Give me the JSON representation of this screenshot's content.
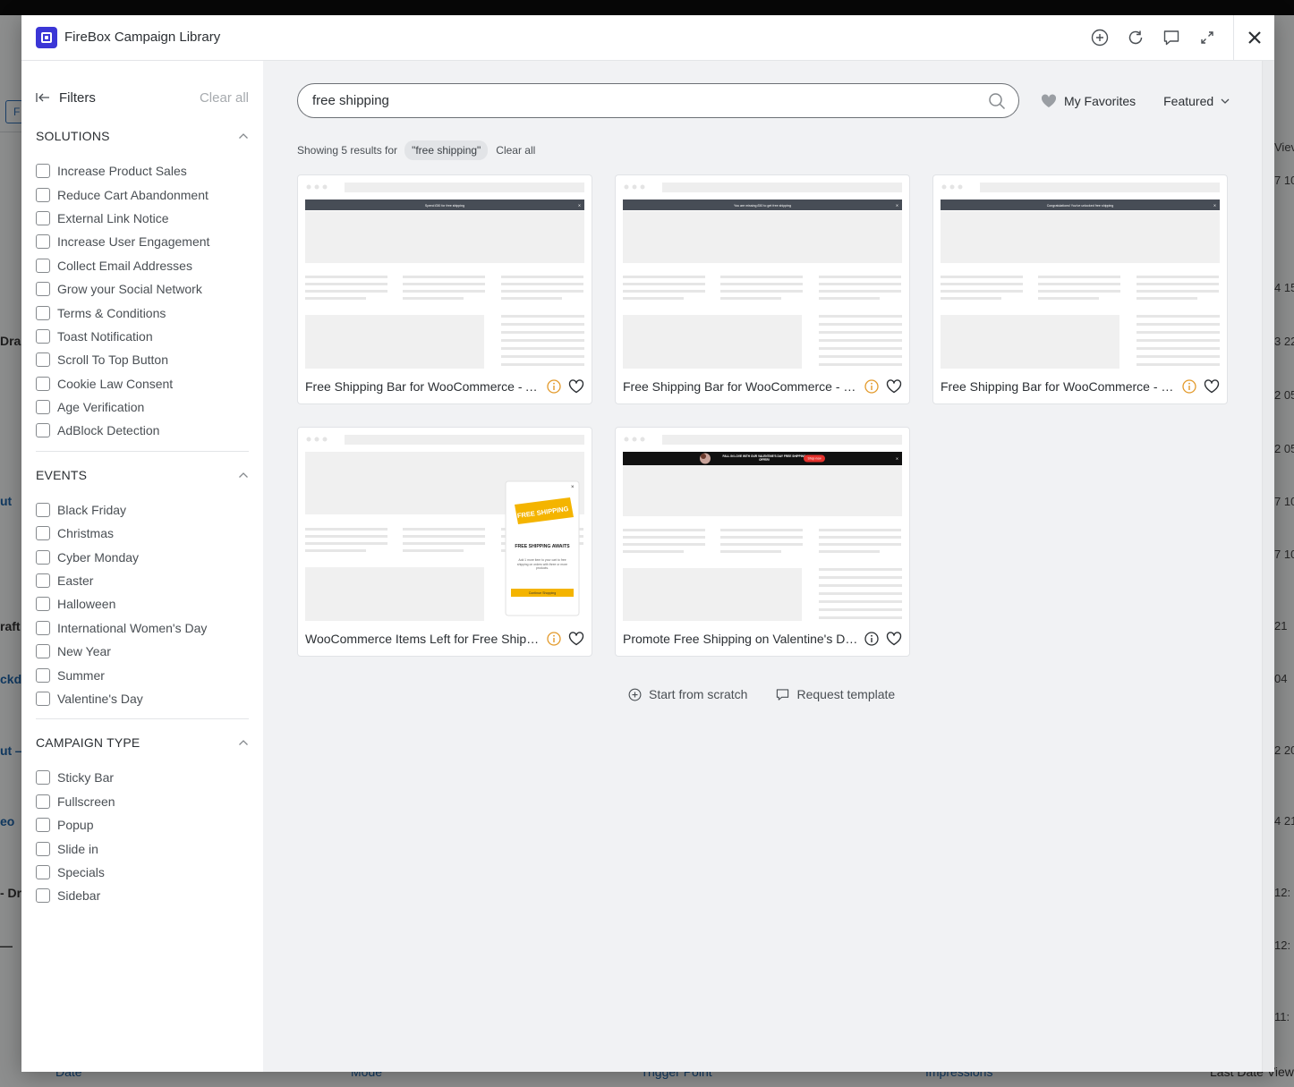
{
  "background": {
    "left_fragments": [
      "Dra",
      "ut",
      "raft",
      "ckd",
      "ut —",
      "eo",
      "- Dr",
      "—"
    ],
    "right_fragments": [
      "Viev",
      "7 10",
      "4 15",
      "3 22",
      "2 05",
      "2 05",
      "7 10",
      "7 10",
      "21",
      "04",
      "2 20",
      "4 21",
      "12:",
      "12:",
      "11:"
    ],
    "button_glyph": "F",
    "footer": [
      "Date",
      "Mode",
      "Trigger Point",
      "Impressions",
      "Last Date View"
    ]
  },
  "modal": {
    "title": "FireBox Campaign Library",
    "header_icons": [
      "plus-circle-icon",
      "refresh-icon",
      "comment-icon",
      "expand-icon",
      "close-icon"
    ]
  },
  "sidebar": {
    "filters_label": "Filters",
    "clear_all": "Clear all",
    "sections": [
      {
        "title": "SOLUTIONS",
        "options": [
          "Increase Product Sales",
          "Reduce Cart Abandonment",
          "External Link Notice",
          "Increase User Engagement",
          "Collect Email Addresses",
          "Grow your Social Network",
          "Terms & Conditions",
          "Toast Notification",
          "Scroll To Top Button",
          "Cookie Law Consent",
          "Age Verification",
          "AdBlock Detection"
        ]
      },
      {
        "title": "EVENTS",
        "options": [
          "Black Friday",
          "Christmas",
          "Cyber Monday",
          "Easter",
          "Halloween",
          "International Women's Day",
          "New Year",
          "Summer",
          "Valentine's Day"
        ]
      },
      {
        "title": "CAMPAIGN TYPE",
        "options": [
          "Sticky Bar",
          "Fullscreen",
          "Popup",
          "Slide in",
          "Specials",
          "Sidebar"
        ]
      }
    ]
  },
  "search": {
    "value": "free shipping",
    "placeholder": "Search"
  },
  "favorites_label": "My Favorites",
  "sort_label": "Featured",
  "results": {
    "prefix": "Showing 5 results for",
    "query_chip": "\"free shipping\"",
    "clear_label": "Clear all"
  },
  "cards": [
    {
      "title": "Free Shipping Bar for WooCommerce - An...",
      "info_color": "#e39a2b",
      "banner_text": "Spend £50 for free shipping",
      "preview": "bar"
    },
    {
      "title": "Free Shipping Bar for WooCommerce - Re...",
      "info_color": "#e39a2b",
      "banner_text": "You are missing £50 to get free shipping",
      "preview": "bar"
    },
    {
      "title": "Free Shipping Bar for WooCommerce - Go...",
      "info_color": "#e39a2b",
      "banner_text": "Congratulations! You've unlocked free shipping",
      "preview": "bar"
    },
    {
      "title": "WooCommerce Items Left for Free Shippi...",
      "info_color": "#e39a2b",
      "preview": "popup",
      "popup": {
        "ribbon": "FREE SHIPPING",
        "heading": "FREE SHIPPING AWAITS",
        "body": "Add 1 more item to your cart to free shipping on orders with three or more products.",
        "button": "Continue Shopping"
      }
    },
    {
      "title": "Promote Free Shipping on Valentine's Day ...",
      "info_color": "#2b2f33",
      "preview": "valentine",
      "banner_text": "FALL IN LOVE WITH OUR VALENTINE'S DAY FREE SHIPPING OFFER!",
      "banner_button": "Shop now"
    }
  ],
  "bottom_actions": {
    "start_label": "Start from scratch",
    "request_label": "Request template"
  },
  "colors": {
    "brand": "#3b36d6",
    "warning": "#e39a2b",
    "bar_dark": "#474d56",
    "popup_yellow": "#f4b400"
  }
}
